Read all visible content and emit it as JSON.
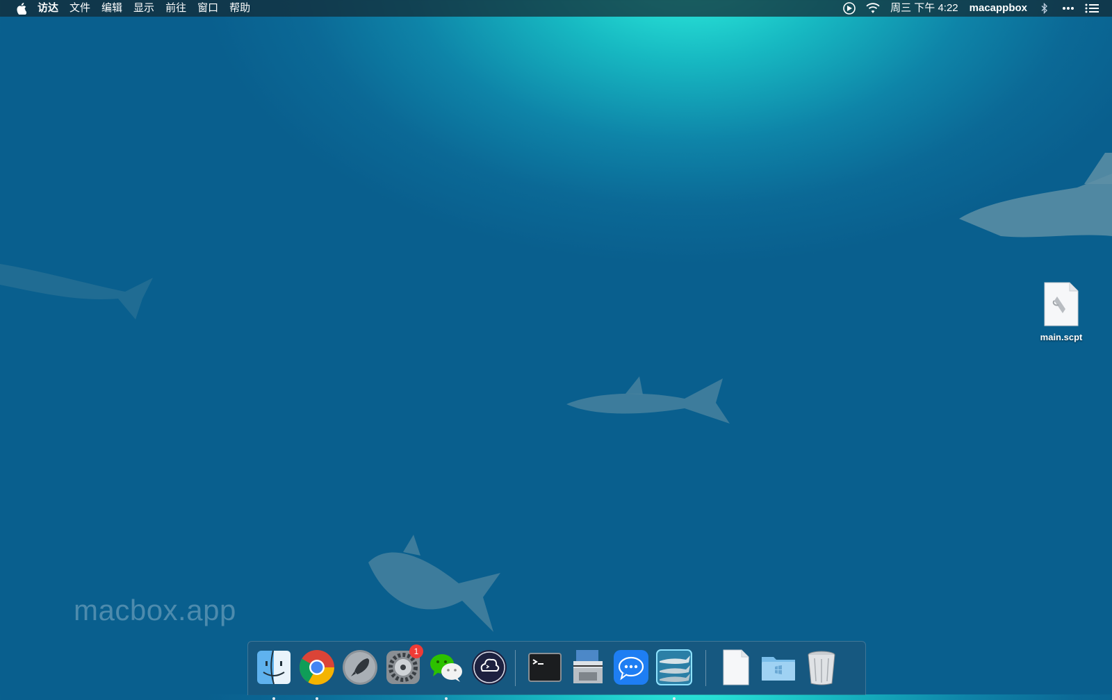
{
  "menubar": {
    "apple_icon": "apple-logo-icon",
    "items": [
      "访达",
      "文件",
      "编辑",
      "显示",
      "前往",
      "窗口",
      "帮助"
    ],
    "clock": "周三 下午 4:22",
    "user": "macappbox"
  },
  "desktop": {
    "watermark": "macbox.app",
    "file_label": "main.scpt"
  },
  "dock": {
    "badge_count": "1",
    "apps": [
      {
        "name": "finder",
        "running": true
      },
      {
        "name": "chrome",
        "running": true
      },
      {
        "name": "launchpad",
        "running": false
      },
      {
        "name": "system-preferences",
        "running": false
      },
      {
        "name": "wechat",
        "running": true
      },
      {
        "name": "dark-app",
        "running": false
      },
      {
        "name": "terminal",
        "running": false
      },
      {
        "name": "scanner",
        "running": false
      },
      {
        "name": "messages",
        "running": false
      },
      {
        "name": "shark-screensaver",
        "running": true
      },
      {
        "name": "document",
        "running": false
      },
      {
        "name": "folder",
        "running": false
      },
      {
        "name": "trash",
        "running": false
      }
    ]
  },
  "colors": {
    "water_light": "#2ff3df",
    "water_deep": "#095f8e",
    "badge": "#ef3b36"
  }
}
